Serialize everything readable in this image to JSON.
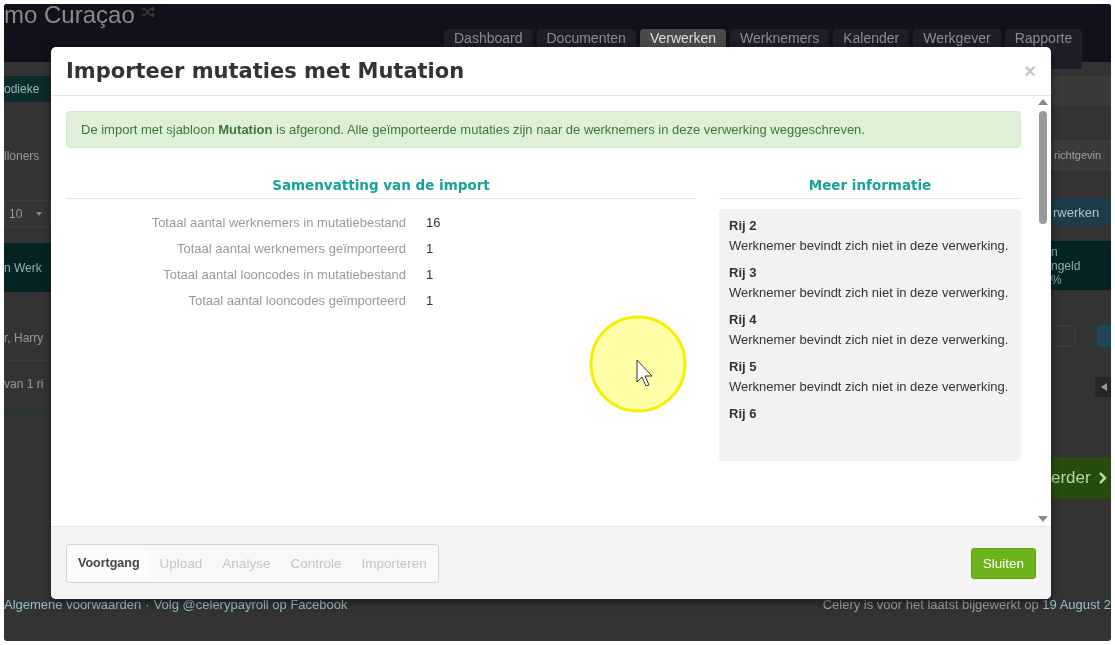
{
  "app_title": "mo Curaçao",
  "nav_tabs": [
    {
      "label": "Dashboard",
      "selected": false
    },
    {
      "label": "Documenten",
      "selected": false
    },
    {
      "label": "Verwerken",
      "selected": true
    },
    {
      "label": "Werknemers",
      "selected": false
    },
    {
      "label": "Kalender",
      "selected": false
    },
    {
      "label": "Werkgever",
      "selected": false
    },
    {
      "label": "Rapporte",
      "selected": false
    }
  ],
  "page_behind": {
    "banner_text": "odieke",
    "label_text": "lloners",
    "page_size": "10",
    "table_header": "n Werk",
    "row_name": "r, Harry",
    "paging_info": "van 1 ri",
    "search_placeholder": "richtgevin",
    "process_button": "rwerken",
    "header_right_lines": [
      "n",
      "ngeld",
      "%"
    ],
    "next_button": "erder"
  },
  "footer": {
    "terms_link": "Algemene voorwaarden",
    "separator": "·",
    "facebook_link": "Volg @celerypayroll op Facebook",
    "update_text": "Celery is voor het laatst bijgewerkt op ",
    "update_date": "19 August 2"
  },
  "modal": {
    "title": "Importeer mutaties met Mutation",
    "close": "×",
    "alert": "De import met sjabloon **Mutation** is afgerond. Alle geïmporteerde mutaties zijn naar de werknemers in deze verwerking weggeschreven.",
    "summary": {
      "heading": "Samenvatting van de import",
      "rows": [
        {
          "label": "Totaal aantal werknemers in mutatiebestand",
          "value": "16"
        },
        {
          "label": "Totaal aantal werknemers geïmporteerd",
          "value": "1"
        },
        {
          "label": "Totaal aantal looncodes in mutatiebestand",
          "value": "1"
        },
        {
          "label": "Totaal aantal looncodes geïmporteerd",
          "value": "1"
        }
      ]
    },
    "info": {
      "heading": "Meer informatie",
      "items": [
        {
          "title": "Rij 2",
          "text": "Werknemer bevindt zich niet in deze verwerking."
        },
        {
          "title": "Rij 3",
          "text": "Werknemer bevindt zich niet in deze verwerking."
        },
        {
          "title": "Rij 4",
          "text": "Werknemer bevindt zich niet in deze verwerking."
        },
        {
          "title": "Rij 5",
          "text": "Werknemer bevindt zich niet in deze verwerking."
        },
        {
          "title": "Rij 6"
        }
      ]
    },
    "steps": [
      {
        "label": "Voortgang",
        "selected": true
      },
      {
        "label": "Upload",
        "selected": false
      },
      {
        "label": "Analyse",
        "selected": false
      },
      {
        "label": "Controle",
        "selected": false
      },
      {
        "label": "Importeren",
        "selected": false
      }
    ],
    "close_button": "Sluiten"
  }
}
